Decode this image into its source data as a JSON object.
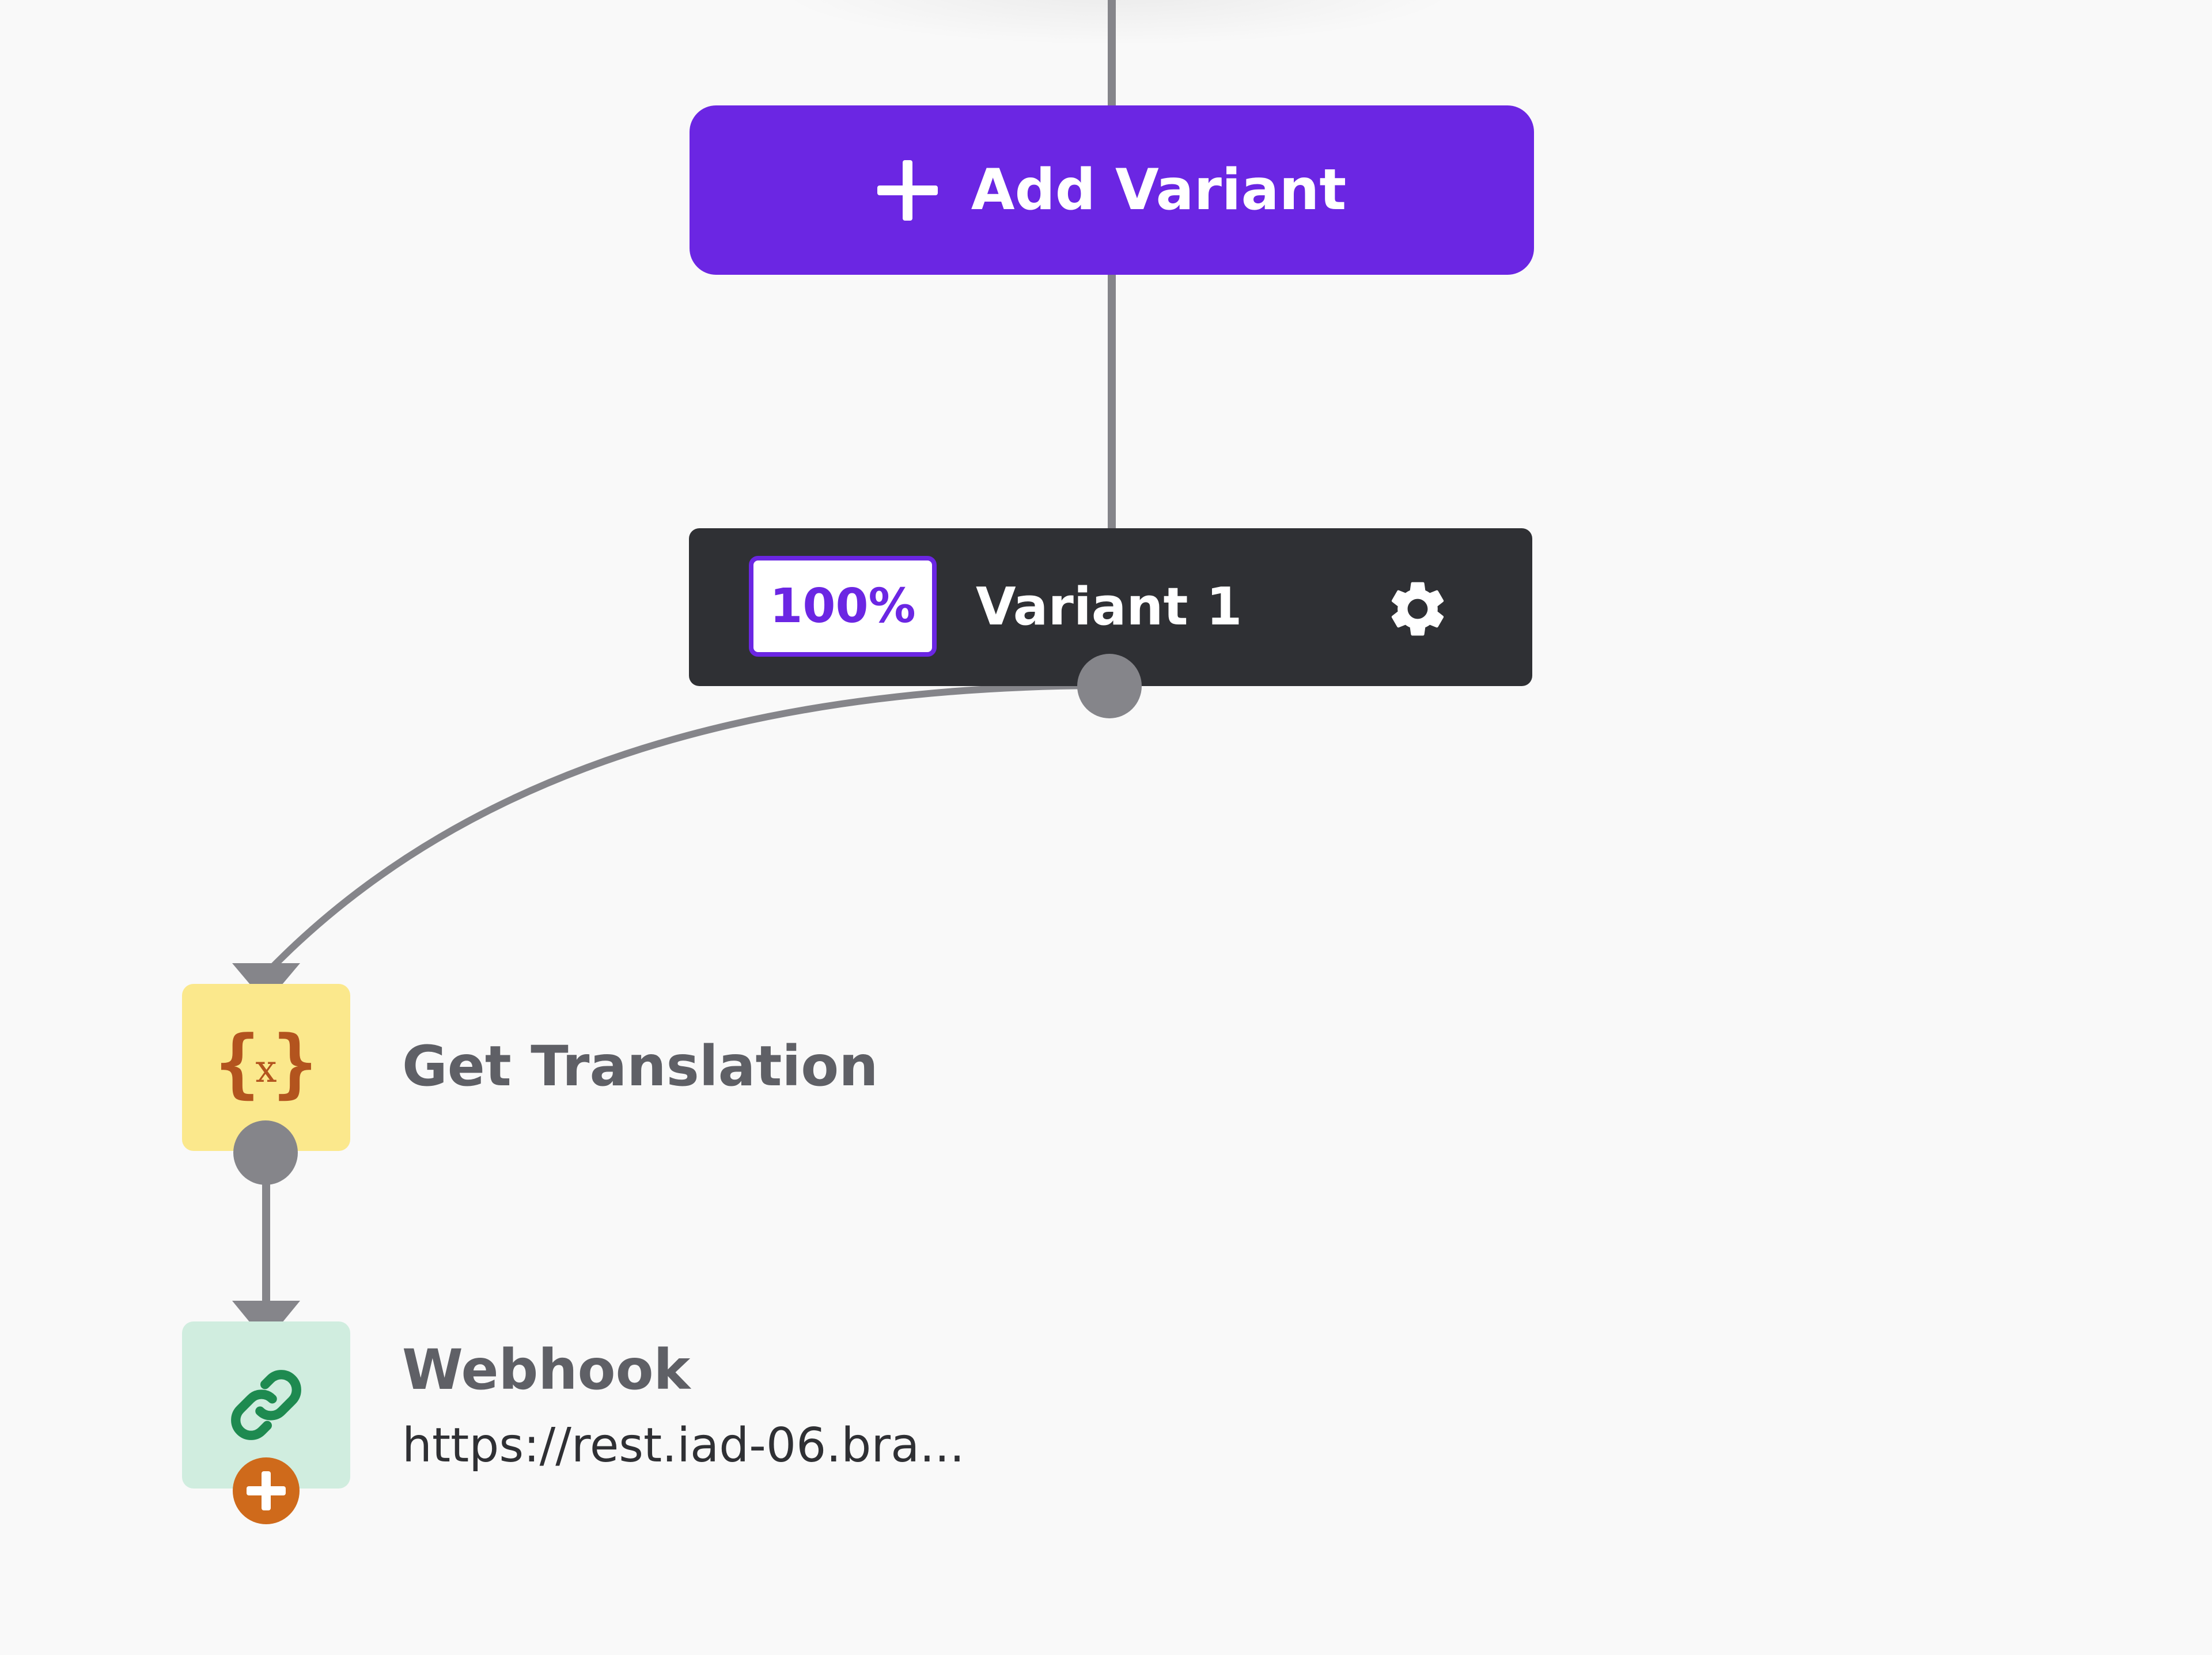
{
  "canvas": {
    "add_variant_label": "Add Variant",
    "variant": {
      "percent": "100%",
      "name": "Variant 1"
    },
    "steps": [
      {
        "title": "Get Translation",
        "icon": "code-variable-icon"
      },
      {
        "title": "Webhook",
        "subtitle": "https://rest.iad-06.bra...",
        "icon": "link-icon"
      }
    ]
  },
  "colors": {
    "accent": "#6b26e3",
    "node_dark": "#2f3034",
    "edge": "#85858a",
    "translation_bg": "#fbe88c",
    "translation_fg": "#b3541e",
    "webhook_bg": "#d0eddf",
    "webhook_fg": "#1e8a50",
    "add_step": "#cf6a1b",
    "canvas_bg": "#f9f9f9"
  }
}
